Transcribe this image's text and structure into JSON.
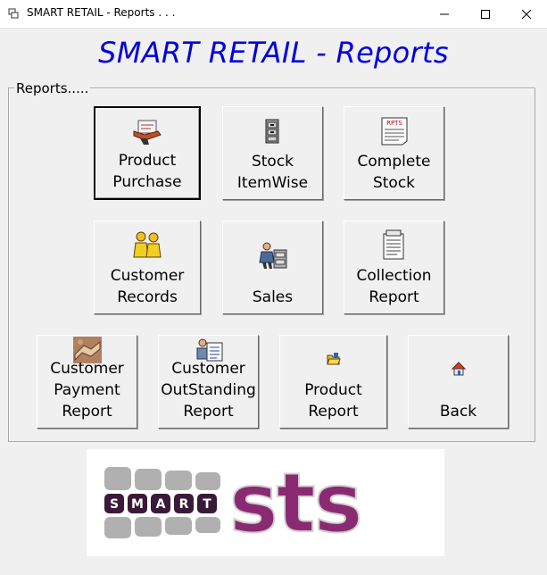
{
  "window": {
    "title": "SMART RETAIL - Reports . . ."
  },
  "heading": "SMART RETAIL - Reports",
  "group": {
    "label": "Reports....."
  },
  "buttons": {
    "product_purchase": "Product\nPurchase",
    "stock_itemwise": "Stock\nItemWise",
    "complete_stock": "Complete\nStock",
    "customer_records": "Customer\nRecords",
    "sales": "Sales",
    "collection_report": "Collection\nReport",
    "customer_payment_report": "Customer\nPayment\nReport",
    "customer_outstanding_report": "Customer\nOutStanding\nReport",
    "product_report": "Product\nReport",
    "back": "Back"
  },
  "icons": {
    "rpts_text": "RPTS"
  },
  "logo": {
    "smart_letters": [
      "S",
      "M",
      "A",
      "R",
      "T"
    ],
    "sts_text": "sts"
  },
  "colors": {
    "heading": "#0000e0",
    "logo_purple": "#8a2a72",
    "logo_gray": "#9a9a9a"
  }
}
